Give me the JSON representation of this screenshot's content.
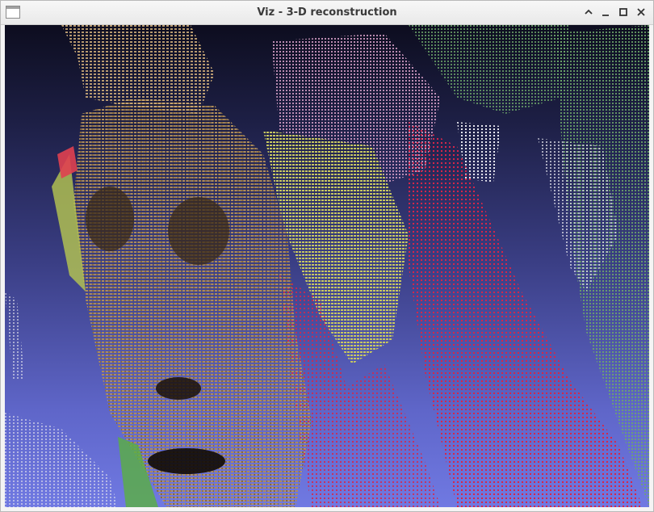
{
  "window": {
    "title": "Viz - 3-D reconstruction",
    "controls": [
      "collapse",
      "minimize",
      "maximize",
      "close"
    ]
  },
  "viewport": {
    "content": "point-cloud",
    "background_top": "#0d0d1f",
    "background_bottom": "#7079e2"
  },
  "icons": {
    "app": "window-app-icon",
    "collapse": "chevron-up-icon",
    "minimize": "minimize-icon",
    "maximize": "maximize-icon",
    "close": "close-icon"
  }
}
